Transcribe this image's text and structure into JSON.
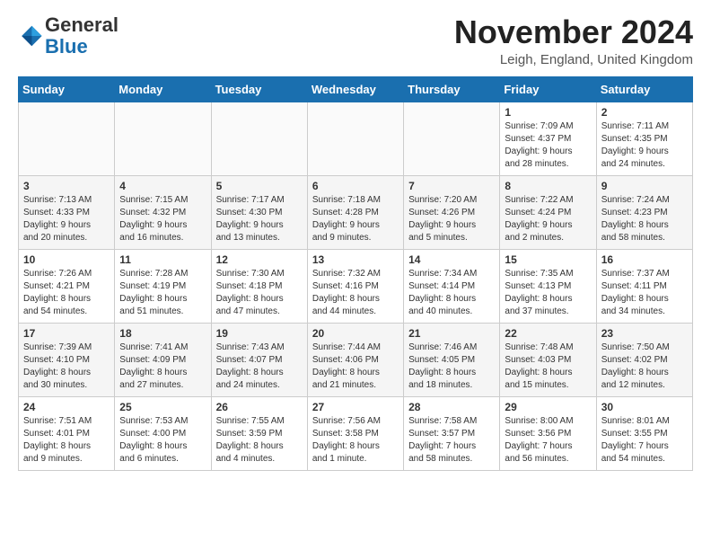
{
  "header": {
    "logo_general": "General",
    "logo_blue": "Blue",
    "month_title": "November 2024",
    "location": "Leigh, England, United Kingdom"
  },
  "weekdays": [
    "Sunday",
    "Monday",
    "Tuesday",
    "Wednesday",
    "Thursday",
    "Friday",
    "Saturday"
  ],
  "weeks": [
    [
      {
        "day": "",
        "info": ""
      },
      {
        "day": "",
        "info": ""
      },
      {
        "day": "",
        "info": ""
      },
      {
        "day": "",
        "info": ""
      },
      {
        "day": "",
        "info": ""
      },
      {
        "day": "1",
        "info": "Sunrise: 7:09 AM\nSunset: 4:37 PM\nDaylight: 9 hours\nand 28 minutes."
      },
      {
        "day": "2",
        "info": "Sunrise: 7:11 AM\nSunset: 4:35 PM\nDaylight: 9 hours\nand 24 minutes."
      }
    ],
    [
      {
        "day": "3",
        "info": "Sunrise: 7:13 AM\nSunset: 4:33 PM\nDaylight: 9 hours\nand 20 minutes."
      },
      {
        "day": "4",
        "info": "Sunrise: 7:15 AM\nSunset: 4:32 PM\nDaylight: 9 hours\nand 16 minutes."
      },
      {
        "day": "5",
        "info": "Sunrise: 7:17 AM\nSunset: 4:30 PM\nDaylight: 9 hours\nand 13 minutes."
      },
      {
        "day": "6",
        "info": "Sunrise: 7:18 AM\nSunset: 4:28 PM\nDaylight: 9 hours\nand 9 minutes."
      },
      {
        "day": "7",
        "info": "Sunrise: 7:20 AM\nSunset: 4:26 PM\nDaylight: 9 hours\nand 5 minutes."
      },
      {
        "day": "8",
        "info": "Sunrise: 7:22 AM\nSunset: 4:24 PM\nDaylight: 9 hours\nand 2 minutes."
      },
      {
        "day": "9",
        "info": "Sunrise: 7:24 AM\nSunset: 4:23 PM\nDaylight: 8 hours\nand 58 minutes."
      }
    ],
    [
      {
        "day": "10",
        "info": "Sunrise: 7:26 AM\nSunset: 4:21 PM\nDaylight: 8 hours\nand 54 minutes."
      },
      {
        "day": "11",
        "info": "Sunrise: 7:28 AM\nSunset: 4:19 PM\nDaylight: 8 hours\nand 51 minutes."
      },
      {
        "day": "12",
        "info": "Sunrise: 7:30 AM\nSunset: 4:18 PM\nDaylight: 8 hours\nand 47 minutes."
      },
      {
        "day": "13",
        "info": "Sunrise: 7:32 AM\nSunset: 4:16 PM\nDaylight: 8 hours\nand 44 minutes."
      },
      {
        "day": "14",
        "info": "Sunrise: 7:34 AM\nSunset: 4:14 PM\nDaylight: 8 hours\nand 40 minutes."
      },
      {
        "day": "15",
        "info": "Sunrise: 7:35 AM\nSunset: 4:13 PM\nDaylight: 8 hours\nand 37 minutes."
      },
      {
        "day": "16",
        "info": "Sunrise: 7:37 AM\nSunset: 4:11 PM\nDaylight: 8 hours\nand 34 minutes."
      }
    ],
    [
      {
        "day": "17",
        "info": "Sunrise: 7:39 AM\nSunset: 4:10 PM\nDaylight: 8 hours\nand 30 minutes."
      },
      {
        "day": "18",
        "info": "Sunrise: 7:41 AM\nSunset: 4:09 PM\nDaylight: 8 hours\nand 27 minutes."
      },
      {
        "day": "19",
        "info": "Sunrise: 7:43 AM\nSunset: 4:07 PM\nDaylight: 8 hours\nand 24 minutes."
      },
      {
        "day": "20",
        "info": "Sunrise: 7:44 AM\nSunset: 4:06 PM\nDaylight: 8 hours\nand 21 minutes."
      },
      {
        "day": "21",
        "info": "Sunrise: 7:46 AM\nSunset: 4:05 PM\nDaylight: 8 hours\nand 18 minutes."
      },
      {
        "day": "22",
        "info": "Sunrise: 7:48 AM\nSunset: 4:03 PM\nDaylight: 8 hours\nand 15 minutes."
      },
      {
        "day": "23",
        "info": "Sunrise: 7:50 AM\nSunset: 4:02 PM\nDaylight: 8 hours\nand 12 minutes."
      }
    ],
    [
      {
        "day": "24",
        "info": "Sunrise: 7:51 AM\nSunset: 4:01 PM\nDaylight: 8 hours\nand 9 minutes."
      },
      {
        "day": "25",
        "info": "Sunrise: 7:53 AM\nSunset: 4:00 PM\nDaylight: 8 hours\nand 6 minutes."
      },
      {
        "day": "26",
        "info": "Sunrise: 7:55 AM\nSunset: 3:59 PM\nDaylight: 8 hours\nand 4 minutes."
      },
      {
        "day": "27",
        "info": "Sunrise: 7:56 AM\nSunset: 3:58 PM\nDaylight: 8 hours\nand 1 minute."
      },
      {
        "day": "28",
        "info": "Sunrise: 7:58 AM\nSunset: 3:57 PM\nDaylight: 7 hours\nand 58 minutes."
      },
      {
        "day": "29",
        "info": "Sunrise: 8:00 AM\nSunset: 3:56 PM\nDaylight: 7 hours\nand 56 minutes."
      },
      {
        "day": "30",
        "info": "Sunrise: 8:01 AM\nSunset: 3:55 PM\nDaylight: 7 hours\nand 54 minutes."
      }
    ]
  ]
}
